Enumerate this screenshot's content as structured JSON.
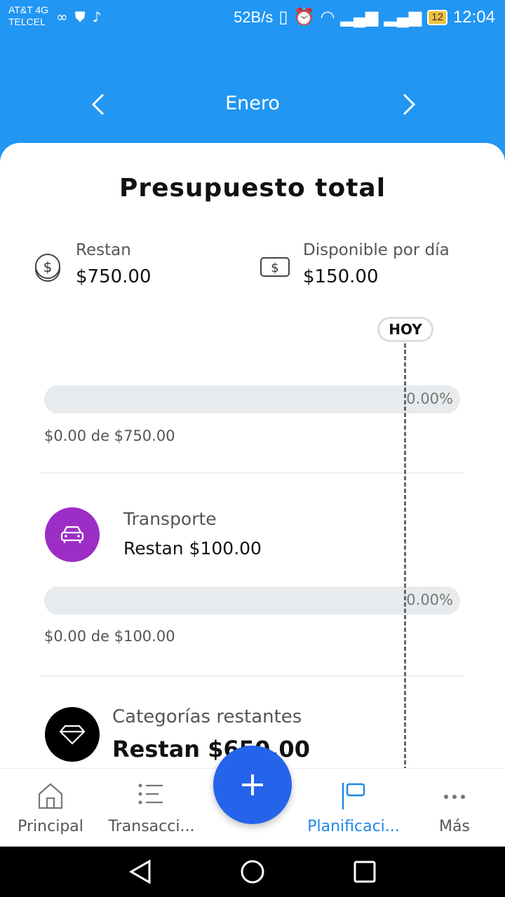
{
  "status": {
    "carrier_line1": "AT&T 4G",
    "carrier_line2": "TELCEL",
    "speed": "52B/s",
    "battery": "12",
    "time": "12:04"
  },
  "header": {
    "month": "Enero"
  },
  "budget": {
    "title": "Presupuesto total",
    "remaining_label": "Restan",
    "remaining_value": "$750.00",
    "daily_label": "Disponible por día",
    "daily_value": "$150.00",
    "today_label": "HOY",
    "total_percent": "0.00%",
    "total_progress": "$0.00 de $750.00"
  },
  "categories": [
    {
      "name": "Transporte",
      "remaining": "Restan  $100.00",
      "percent": "0.00%",
      "progress": "$0.00 de $100.00",
      "color": "#9C2EC5",
      "icon": "car-icon"
    },
    {
      "name": "Categorías restantes",
      "remaining": "Restan  $650.00",
      "color": "#000000",
      "icon": "diamond-icon"
    }
  ],
  "nav": {
    "items": [
      {
        "label": "Principal",
        "icon": "home-icon"
      },
      {
        "label": "Transacci...",
        "icon": "list-icon"
      },
      {
        "label": "Planificaci...",
        "icon": "flag-icon",
        "active": true
      },
      {
        "label": "Más",
        "icon": "more-icon"
      }
    ]
  },
  "colors": {
    "primary": "#2196F3",
    "fab": "#2563EB",
    "active_nav": "#1E88E5"
  }
}
